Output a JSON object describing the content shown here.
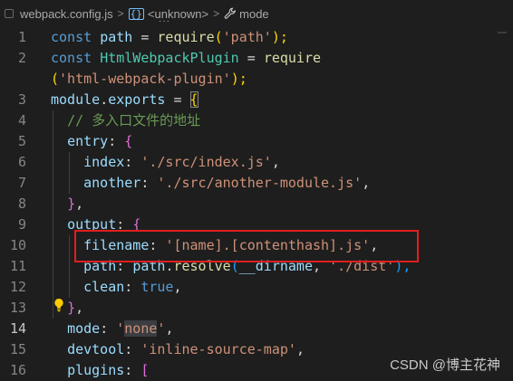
{
  "breadcrumb": {
    "file": "webpack.config.js",
    "symbol": "<unknown>",
    "property": "mode",
    "separator": ">"
  },
  "gutter": [
    "1",
    "2",
    "",
    "3",
    "4",
    "5",
    "6",
    "7",
    "8",
    "9",
    "10",
    "11",
    "12",
    "13",
    "14",
    "15",
    "16"
  ],
  "active_line": "14",
  "code": {
    "l1": {
      "a": "const",
      "b": "path",
      "c": "=",
      "d": "require",
      "e": "(",
      "f": "'path'",
      "g": ");"
    },
    "l2": {
      "a": "const",
      "b": "HtmlWebpackPlugin",
      "c": "=",
      "d": "require"
    },
    "l2b": {
      "a": "(",
      "b": "'html-webpack-plugin'",
      "c": ");"
    },
    "l3": {
      "a": "module",
      "b": ".",
      "c": "exports",
      "d": "=",
      "e": "{"
    },
    "l4": {
      "comment": "// 多入口文件的地址"
    },
    "l5": {
      "a": "entry",
      "b": ":",
      "c": "{"
    },
    "l6": {
      "a": "index",
      "b": ":",
      "c": "'./src/index.js'",
      "d": ","
    },
    "l7": {
      "a": "another",
      "b": ":",
      "c": "'./src/another-module.js'",
      "d": ","
    },
    "l8": {
      "a": "}",
      "b": ","
    },
    "l9": {
      "a": "output",
      "b": ":",
      "c": "{"
    },
    "l10": {
      "a": "filename",
      "b": ":",
      "c": "'[name].[contenthash].js'",
      "d": ","
    },
    "l11": {
      "a": "path",
      "b": ":",
      "c": "path",
      "d": ".",
      "e": "resolve",
      "f": "(",
      "g": "__dirname",
      "h": ",",
      "i": "'./dist'",
      "j": "),"
    },
    "l12": {
      "a": "clean",
      "b": ":",
      "c": "true",
      "d": ","
    },
    "l13": {
      "a": "}",
      "b": ","
    },
    "l14": {
      "a": "mode",
      "b": ":",
      "c": "'",
      "d": "none",
      "e": "'",
      "f": ","
    },
    "l15": {
      "a": "devtool",
      "b": ":",
      "c": "'inline-source-map'",
      "d": ","
    },
    "l16": {
      "a": "plugins",
      "b": ":",
      "c": "["
    }
  },
  "watermark": "CSDN @博主花神",
  "colors": {
    "keyword": "#569cd6",
    "variable": "#9cdcfe",
    "class": "#4ec9b0",
    "function": "#dcdcaa",
    "string": "#ce9178",
    "comment": "#6a9955",
    "highlight_box": "#e01f1f"
  },
  "icons": [
    "js-file-icon",
    "braces-icon",
    "wrench-icon",
    "lightbulb-icon"
  ]
}
